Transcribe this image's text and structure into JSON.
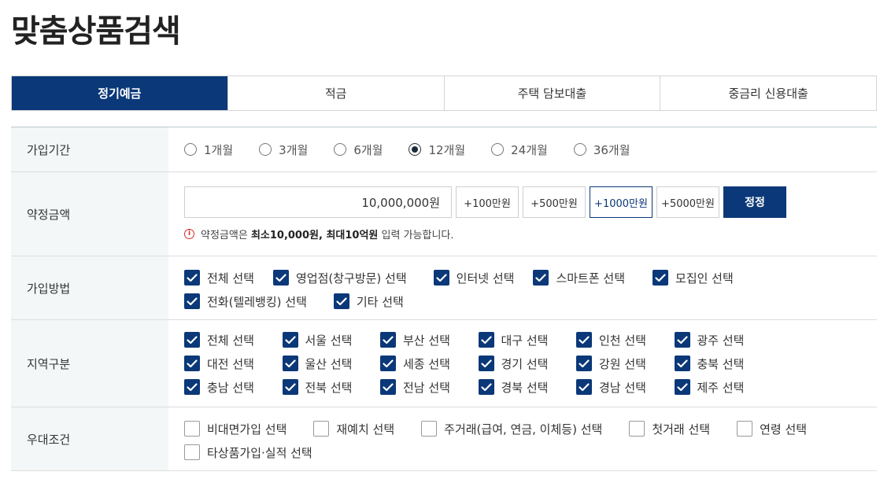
{
  "page_title": "맞춤상품검색",
  "tabs": [
    {
      "label": "정기예금",
      "active": true
    },
    {
      "label": "적금",
      "active": false
    },
    {
      "label": "주택 담보대출",
      "active": false
    },
    {
      "label": "중금리 신용대출",
      "active": false
    }
  ],
  "period": {
    "label": "가입기간",
    "options": [
      {
        "label": "1개월",
        "checked": false
      },
      {
        "label": "3개월",
        "checked": false
      },
      {
        "label": "6개월",
        "checked": false
      },
      {
        "label": "12개월",
        "checked": true
      },
      {
        "label": "24개월",
        "checked": false
      },
      {
        "label": "36개월",
        "checked": false
      }
    ]
  },
  "amount": {
    "label": "약정금액",
    "value": "10,000,000원",
    "buttons": [
      {
        "label": "+100만원",
        "selected": false
      },
      {
        "label": "+500만원",
        "selected": false
      },
      {
        "label": "+1000만원",
        "selected": true
      },
      {
        "label": "+5000만원",
        "selected": false
      }
    ],
    "apply_label": "정정",
    "notice_icon": "i",
    "notice_prefix": "약정금액은 ",
    "notice_bold": "최소10,000원, 최대10억원",
    "notice_suffix": " 입력 가능합니다."
  },
  "method": {
    "label": "가입방법",
    "rows": [
      [
        {
          "label": "전체 선택",
          "checked": true
        },
        {
          "label": "영업점(창구방문) 선택",
          "checked": true
        },
        {
          "label": "인터넷 선택",
          "checked": true
        },
        {
          "label": "스마트폰 선택",
          "checked": true
        },
        {
          "label": "모집인 선택",
          "checked": true
        }
      ],
      [
        {
          "label": "전화(텔레뱅킹) 선택",
          "checked": true
        },
        {
          "label": "기타 선택",
          "checked": true
        }
      ]
    ]
  },
  "region": {
    "label": "지역구분",
    "rows": [
      [
        {
          "label": "전체 선택",
          "checked": true
        },
        {
          "label": "서울 선택",
          "checked": true
        },
        {
          "label": "부산 선택",
          "checked": true
        },
        {
          "label": "대구 선택",
          "checked": true
        },
        {
          "label": "인천 선택",
          "checked": true
        },
        {
          "label": "광주 선택",
          "checked": true
        }
      ],
      [
        {
          "label": "대전 선택",
          "checked": true
        },
        {
          "label": "울산 선택",
          "checked": true
        },
        {
          "label": "세종 선택",
          "checked": true
        },
        {
          "label": "경기 선택",
          "checked": true
        },
        {
          "label": "강원 선택",
          "checked": true
        },
        {
          "label": "충북 선택",
          "checked": true
        }
      ],
      [
        {
          "label": "충남 선택",
          "checked": true
        },
        {
          "label": "전북 선택",
          "checked": true
        },
        {
          "label": "전남 선택",
          "checked": true
        },
        {
          "label": "경북 선택",
          "checked": true
        },
        {
          "label": "경남 선택",
          "checked": true
        },
        {
          "label": "제주 선택",
          "checked": true
        }
      ]
    ]
  },
  "benefit": {
    "label": "우대조건",
    "rows": [
      [
        {
          "label": "비대면가입 선택",
          "checked": false
        },
        {
          "label": "재예치 선택",
          "checked": false
        },
        {
          "label": "주거래(급여, 연금, 이체등) 선택",
          "checked": false
        },
        {
          "label": "첫거래 선택",
          "checked": false
        },
        {
          "label": "연령 선택",
          "checked": false
        }
      ],
      [
        {
          "label": "타상품가입·실적 선택",
          "checked": false
        }
      ]
    ]
  },
  "colors": {
    "primary": "#0b3878",
    "label_bg": "#f3f7f8",
    "notice_icon": "#d0302c"
  }
}
